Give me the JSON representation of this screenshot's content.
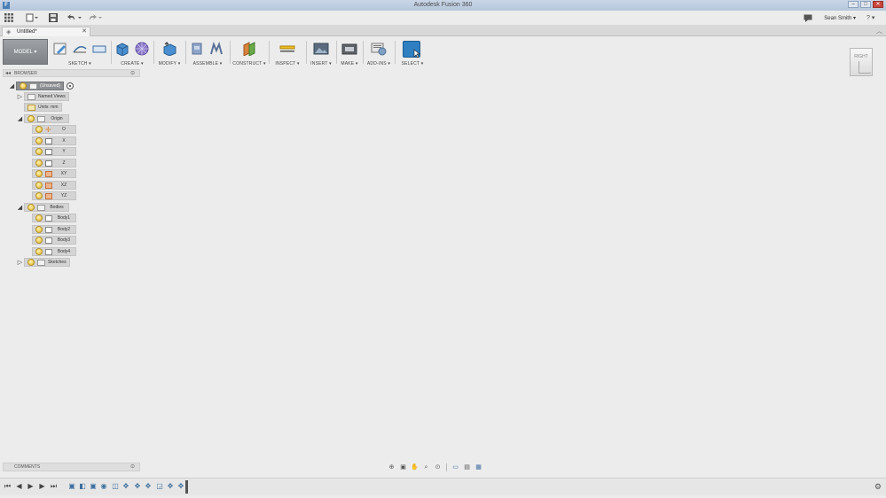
{
  "window": {
    "title": "Autodesk Fusion 360",
    "app_icon_letter": "F",
    "minimize": "–",
    "maximize": "□",
    "close": "✕"
  },
  "quickbar": {
    "user_name": "Sean Smith ▾",
    "help": "? ▾"
  },
  "document_tab": {
    "label": "Untitled*",
    "close": "✕"
  },
  "toolbar": {
    "workspace": "MODEL ▾",
    "groups": [
      {
        "label": "SKETCH ▾"
      },
      {
        "label": "CREATE ▾"
      },
      {
        "label": "MODIFY ▾"
      },
      {
        "label": "ASSEMBLE ▾"
      },
      {
        "label": "CONSTRUCT ▾"
      },
      {
        "label": "INSPECT ▾"
      },
      {
        "label": "INSERT ▾"
      },
      {
        "label": "MAKE ▾"
      },
      {
        "label": "ADD-INS ▾"
      },
      {
        "label": "SELECT ▾"
      }
    ],
    "colors": {
      "select_accent": "#2f7fc1",
      "create_blue": "#4a8fd0",
      "construct_orange": "#d9823b"
    }
  },
  "viewcube": {
    "face_label": "RIGHT"
  },
  "browser": {
    "title": "BROWSER",
    "root": {
      "label": "(Unsaved)"
    },
    "named_views": {
      "label": "Named Views"
    },
    "units": {
      "label": "Units: mm"
    },
    "origin": {
      "label": "Origin",
      "items": [
        {
          "label": "O",
          "type": "point"
        },
        {
          "label": "X",
          "type": "axis"
        },
        {
          "label": "Y",
          "type": "axis"
        },
        {
          "label": "Z",
          "type": "axis"
        },
        {
          "label": "XY",
          "type": "plane"
        },
        {
          "label": "XZ",
          "type": "plane"
        },
        {
          "label": "YZ",
          "type": "plane"
        }
      ]
    },
    "bodies": {
      "label": "Bodies",
      "items": [
        {
          "label": "Body1"
        },
        {
          "label": "Body2"
        },
        {
          "label": "Body3"
        },
        {
          "label": "Body4"
        }
      ]
    },
    "sketches": {
      "label": "Sketches"
    }
  },
  "comments": {
    "title": "COMMENTS"
  }
}
